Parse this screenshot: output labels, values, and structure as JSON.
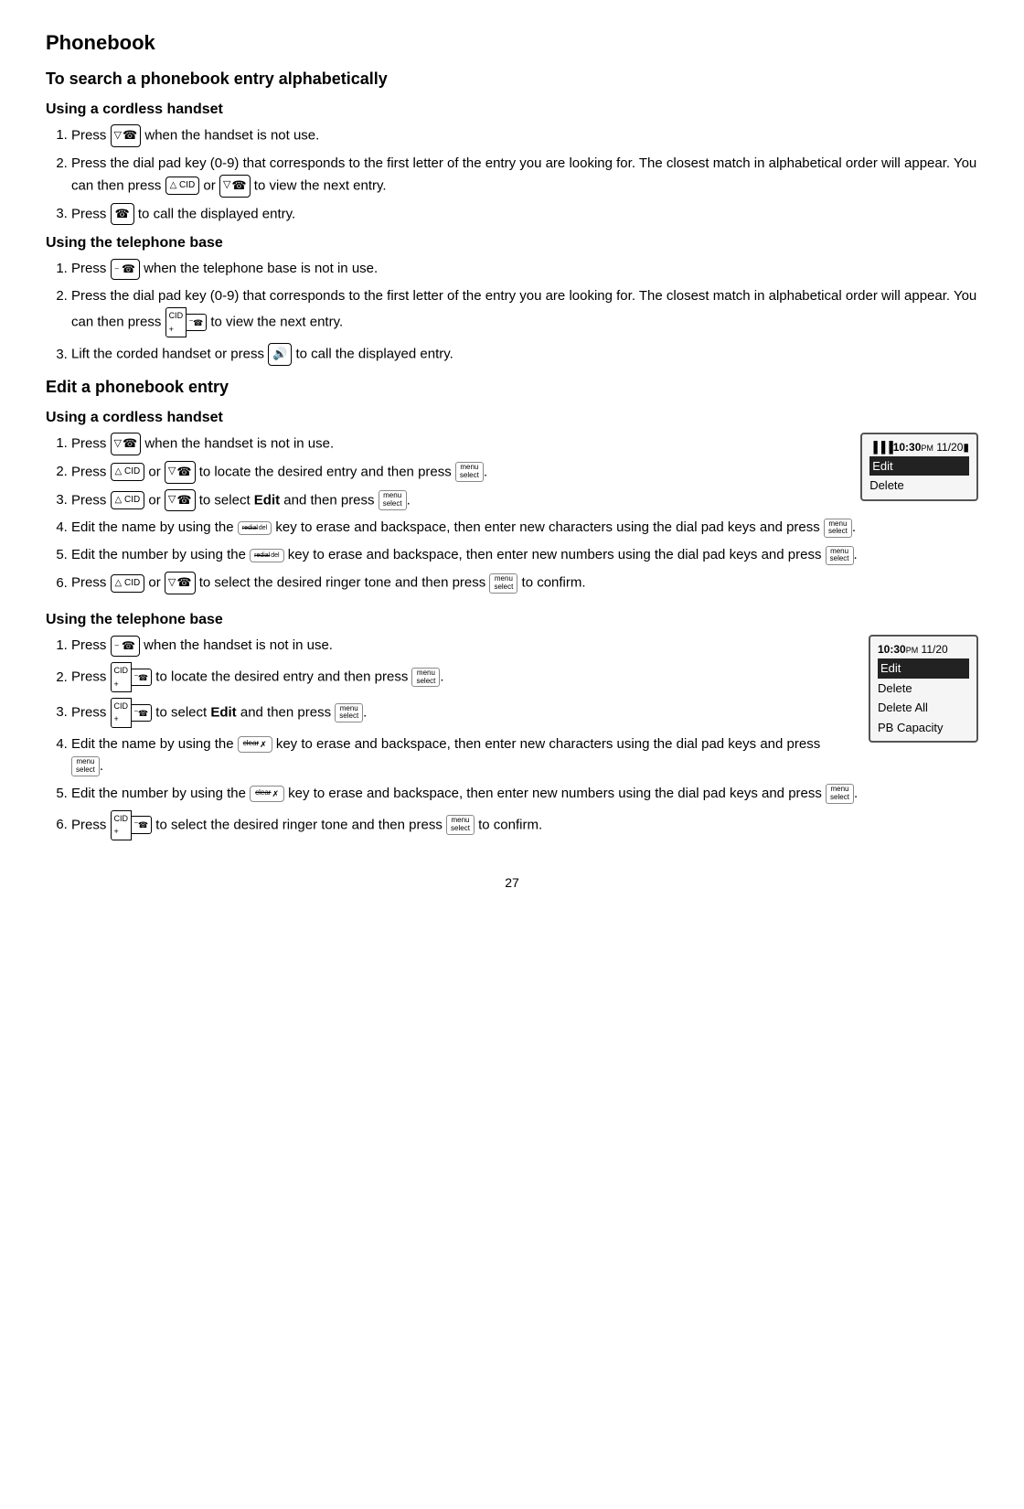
{
  "page": {
    "title": "Phonebook",
    "subtitle": "To search a phonebook entry alphabetically",
    "page_number": "27"
  },
  "sections": {
    "search": {
      "heading": "To search a phonebook entry alphabetically",
      "cordless": {
        "heading": "Using a cordless handset",
        "steps": [
          "Press [nav-handset] when the handset is not use.",
          "Press the dial pad key (0-9) that corresponds to the first letter of the entry you are looking for. The closest match in alphabetical order will appear. You can then press [cid-up] or [nav-handset] to view the next entry.",
          "Press [call] to call the displayed entry."
        ]
      },
      "base": {
        "heading": "Using the telephone base",
        "steps": [
          "Press [base-minus] when the telephone base is not in use.",
          "Press the dial pad key (0-9) that corresponds to the first letter of the entry you are looking for. The closest match in alphabetical order will appear. You can then press [cid-plus] / [base-minus] to view the next entry.",
          "Lift the corded handset or press [speaker] to call the displayed entry."
        ]
      }
    },
    "edit": {
      "heading": "Edit a phonebook entry",
      "cordless": {
        "heading": "Using a cordless handset",
        "steps": [
          "Press [nav-handset] when the handset is not in use.",
          "Press [cid-up] or [nav-handset] to locate the desired entry and then press [menu-select].",
          "Press [cid-up] or [nav-handset] to select Edit and then press [menu-select].",
          "Edit the name by using the [redial-del] key to erase and backspace, then enter new characters using the dial pad keys and press [menu-select].",
          "Edit the number by using the [redial-del] key to erase and backspace, then enter new numbers using the dial pad keys and press [menu-select].",
          "Press [cid-up] or [nav-handset] to select the desired ringer tone and then press [menu-select] to confirm."
        ],
        "screen": {
          "time": "10:30",
          "ampm": "PM",
          "date": "11/20",
          "items": [
            "Edit",
            "Delete"
          ],
          "highlighted": "Edit"
        }
      },
      "base": {
        "heading": "Using the telephone base",
        "steps": [
          "Press [base-minus] when the handset is not in use.",
          "Press [cid-plus] / [base-minus] to locate the desired entry and then press [menu-select].",
          "Press [cid-plus] / [base-minus] to select Edit and then press [menu-select].",
          "Edit the name by using the [clear] key to erase and backspace, then enter new characters using the dial pad keys and press [menu-select].",
          "Edit the number by using the [clear] key to erase and backspace, then enter new numbers using the dial pad keys and press [menu-select].",
          "Press [cid-plus] / [base-minus] to select the desired ringer tone and then press [menu-select] to confirm."
        ],
        "screen": {
          "time": "10:30",
          "ampm": "PM",
          "date": "11/20",
          "items": [
            "Edit",
            "Delete",
            "Delete All",
            "PB Capacity"
          ],
          "highlighted": "Edit"
        }
      }
    }
  },
  "icons": {
    "nav_handset": "▽ ☎",
    "cid_up": "△ CID",
    "menu_top": "menu",
    "menu_bottom": "select",
    "base_minus": "☎",
    "cid_plus_label": "CID",
    "cid_plus_sub": "+",
    "base_minus_label": "☎",
    "base_minus_sub": "–",
    "redial_label": "redial",
    "redial_sub": "del",
    "clear_label": "clear",
    "call_label": "☎",
    "speaker_label": "🔊",
    "signal_icon": "▐▐▐"
  }
}
